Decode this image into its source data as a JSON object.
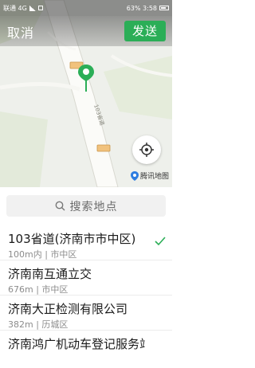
{
  "status_bar": {
    "carrier": "联通 4G",
    "right_text": "63% 3:58"
  },
  "nav": {
    "cancel_label": "取消",
    "send_label": "发送"
  },
  "map": {
    "road_label": "103省道",
    "map_brand": "腾讯地图"
  },
  "search": {
    "placeholder": "搜索地点"
  },
  "places": [
    {
      "name": "103省道(济南市市中区)",
      "distance": "100m内",
      "district": "市中区",
      "selected": true
    },
    {
      "name": "济南南互通立交",
      "distance": "676m",
      "district": "市中区",
      "selected": false
    },
    {
      "name": "济南大正检测有限公司",
      "distance": "382m",
      "district": "历城区",
      "selected": false
    },
    {
      "name": "济南鸿广机动车登记服务站",
      "distance": "",
      "district": "",
      "selected": false
    }
  ],
  "colors": {
    "accent": "#2bae57",
    "check": "#2bae57"
  }
}
